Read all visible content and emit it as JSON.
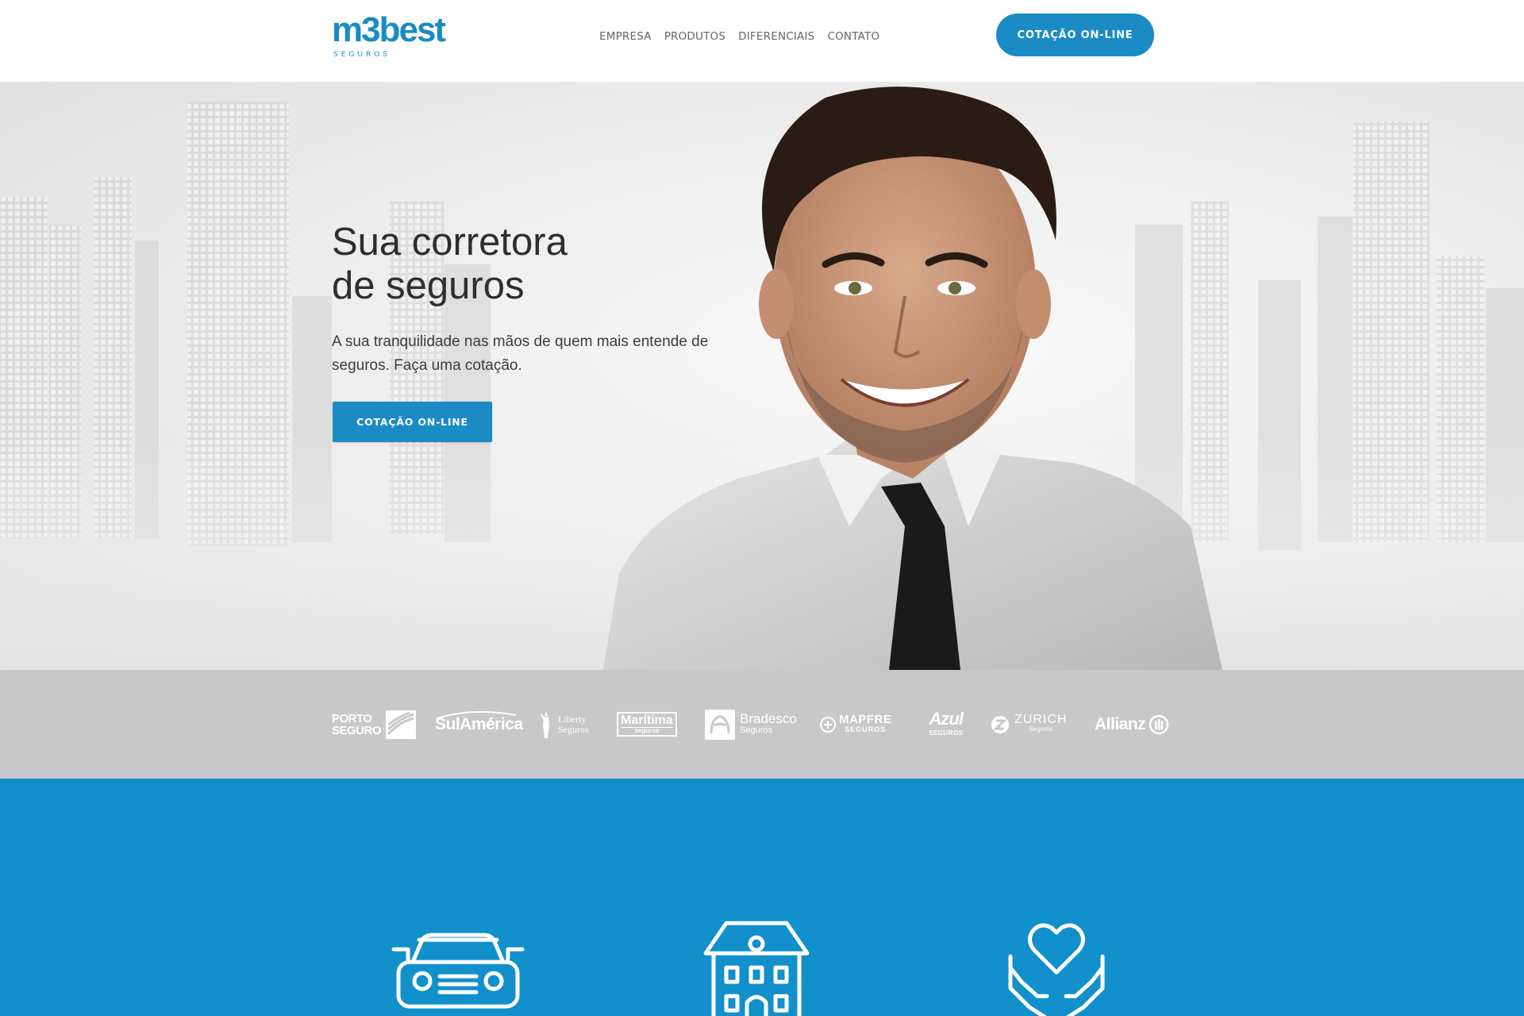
{
  "brand": {
    "name": "m3best",
    "tagline": "SEGUROS",
    "accent_color": "#1a8bc5",
    "services_bg_color": "#1190cb"
  },
  "nav": {
    "items": [
      "EMPRESA",
      "PRODUTOS",
      "DIFERENCIAIS",
      "CONTATO"
    ],
    "cta_label": "COTAÇÃO ON-LINE"
  },
  "hero": {
    "title_line1": "Sua corretora",
    "title_line2": "de seguros",
    "description": "A sua tranquilidade nas mãos de quem mais entende de seguros. Faça uma cotação.",
    "cta_label": "COTAÇÃO ON-LINE"
  },
  "partners": [
    {
      "name": "PORTO SEGURO",
      "line1": "PORTO",
      "line2": "SEGURO"
    },
    {
      "name": "SulAmérica",
      "line1": "SulAmérica"
    },
    {
      "name": "Liberty Seguros",
      "line1": "Liberty",
      "line2": "Seguros"
    },
    {
      "name": "Marítima seguros",
      "line1": "Marítima",
      "line2": "seguros"
    },
    {
      "name": "Bradesco Seguros",
      "line1": "Bradesco",
      "line2": "Seguros"
    },
    {
      "name": "MAPFRE SEGUROS",
      "line1": "MAPFRE",
      "line2": "SEGUROS"
    },
    {
      "name": "Azul SEGUROS",
      "line1": "Azul",
      "line2": "SEGUROS"
    },
    {
      "name": "ZURICH Seguros",
      "line1": "ZURICH",
      "line2": "Seguros"
    },
    {
      "name": "Allianz",
      "line1": "Allianz"
    }
  ],
  "services": [
    {
      "icon": "car-icon"
    },
    {
      "icon": "house-icon"
    },
    {
      "icon": "heart-hands-icon"
    }
  ]
}
